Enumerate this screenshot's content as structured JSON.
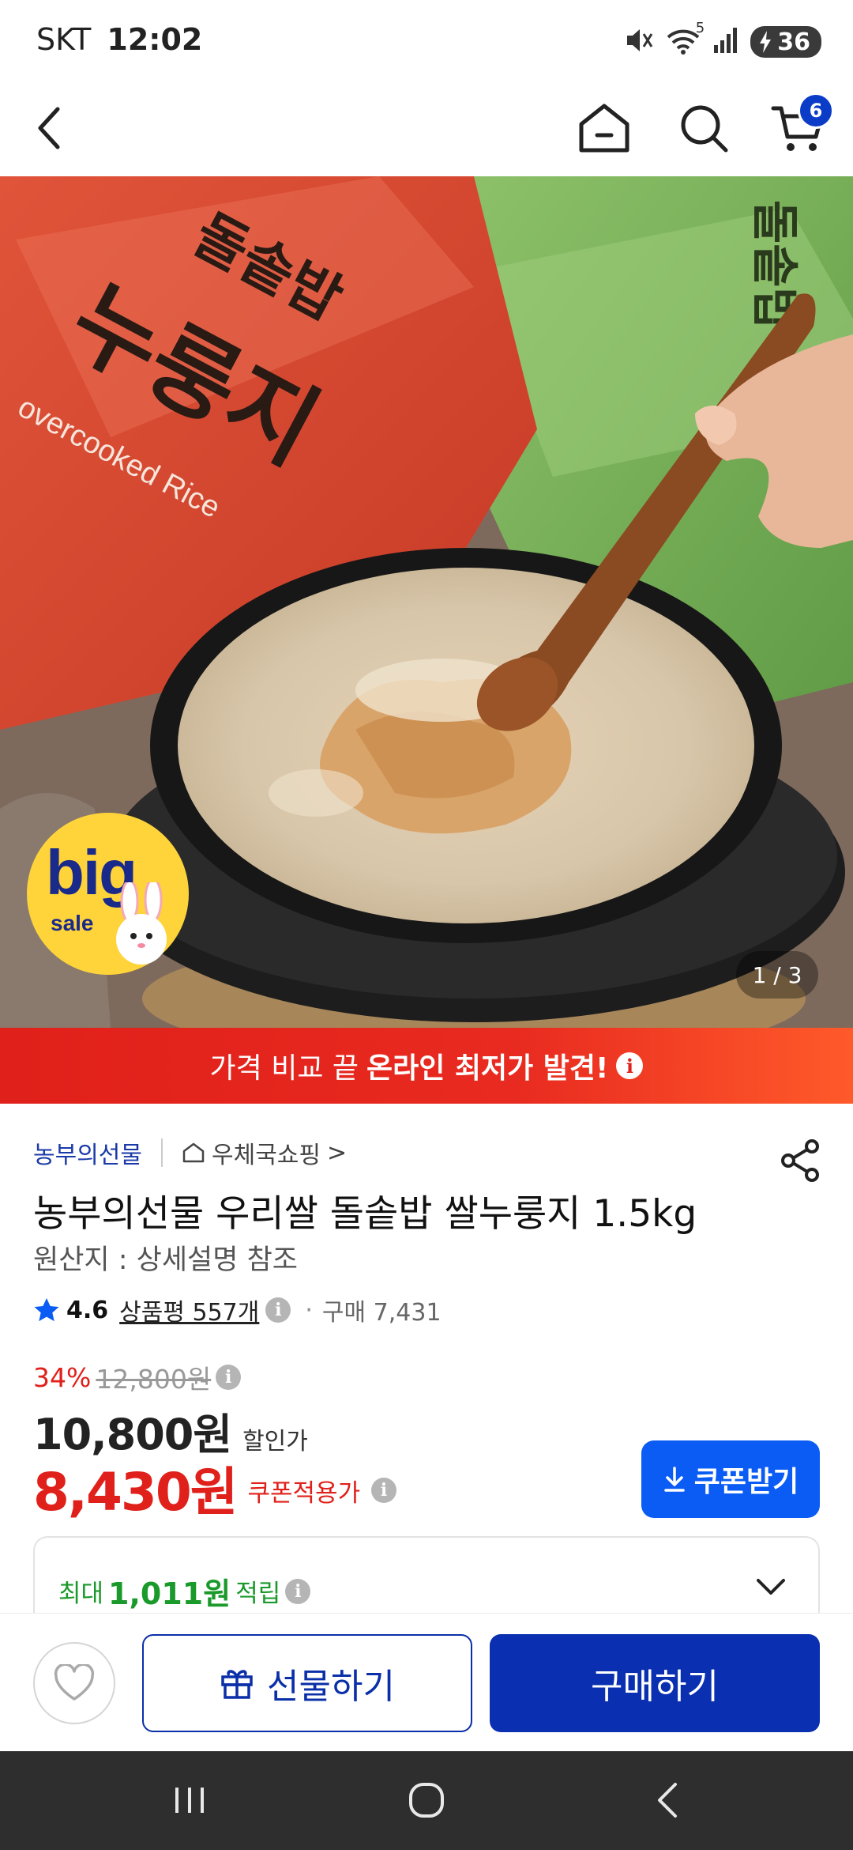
{
  "status_bar": {
    "carrier": "SKT",
    "time": "12:02",
    "wifi_label": "5",
    "battery": "36"
  },
  "nav": {
    "cart_count": "6"
  },
  "hero": {
    "bag_text_line1": "돌솥밥",
    "bag_text_line2": "누룽지",
    "bag_text_english": "overcooked Rice",
    "badge_big": "big",
    "badge_sale": "sale",
    "pager": "1 / 3"
  },
  "promo": {
    "text_normal": "가격 비교 끝",
    "text_highlight": "온라인 최저가 발견!",
    "info": "i"
  },
  "product": {
    "seller": "농부의선물",
    "mall": "우체국쇼핑",
    "mall_arrow": ">",
    "title": "농부의선물 우리쌀 돌솥밥 쌀누룽지 1.5kg",
    "origin": "원산지 : 상세설명 참조",
    "rating": "4.6",
    "review_label": "상품평 557개",
    "info_glyph": "i",
    "separator": "·",
    "purchase": "구매 7,431"
  },
  "price": {
    "discount_pct": "34%",
    "original": "12,800원",
    "sale_price": "10,800원",
    "sale_label": "할인가",
    "coupon_price": "8,430원",
    "coupon_label": "쿠폰적용가",
    "coupon_button": "쿠폰받기"
  },
  "points": {
    "prefix": "최대",
    "amount": "1,011원",
    "suffix": "적립"
  },
  "actions": {
    "gift": "선물하기",
    "buy": "구매하기"
  },
  "colors": {
    "accent_blue": "#0a2fb0",
    "coupon_blue": "#0a5cf5",
    "sale_red": "#e0201a",
    "points_green": "#1a9a2a"
  }
}
